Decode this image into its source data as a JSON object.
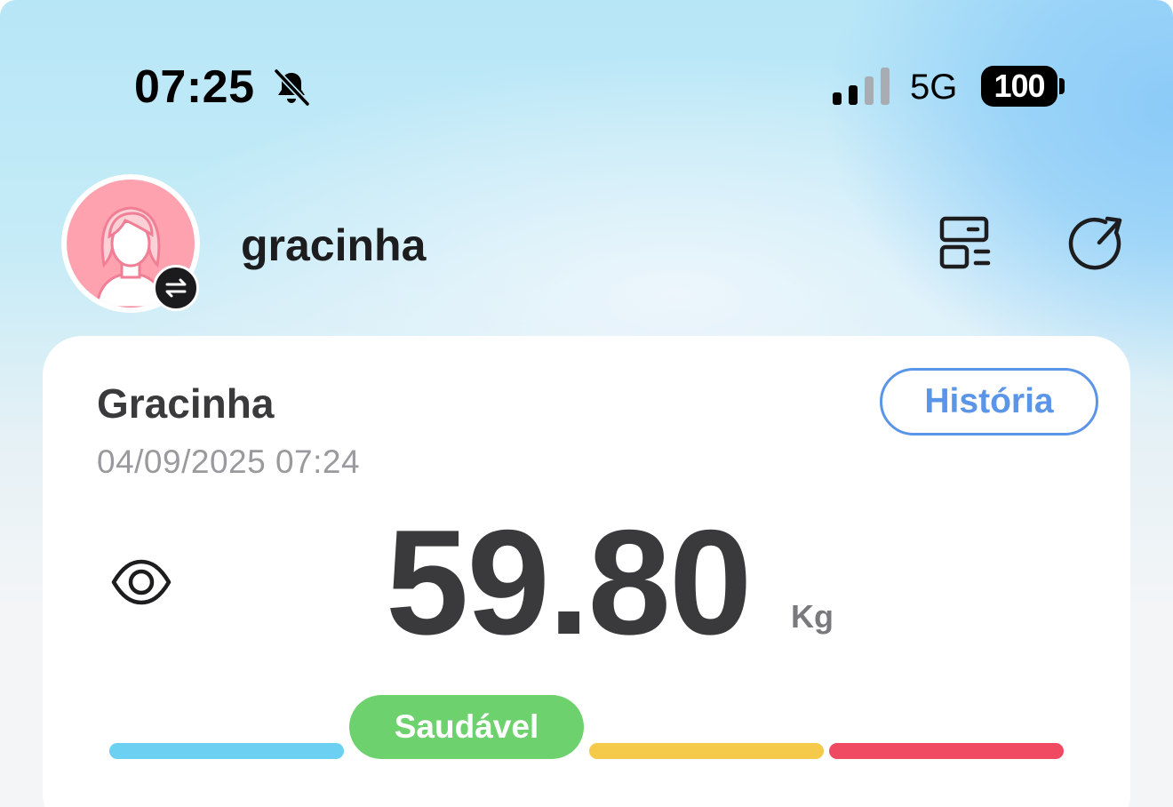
{
  "status_bar": {
    "time": "07:25",
    "silent_icon": "bell-slash-icon",
    "signal_icon": "cellular-signal-icon",
    "network": "5G",
    "battery": "100"
  },
  "profile": {
    "username": "gracinha",
    "avatar_icon": "female-user-avatar",
    "switch_icon": "swap-arrows-icon",
    "device_icon": "device-manage-icon",
    "refresh_icon": "refresh-icon"
  },
  "measurement": {
    "name": "Gracinha",
    "datetime": "04/09/2025 07:24",
    "history_label": "História",
    "visibility_icon": "eye-icon",
    "weight": "59.80",
    "unit": "Kg",
    "status_label": "Saudável"
  },
  "range_bar": {
    "segments": [
      {
        "color": "#6bd0f2"
      },
      {
        "color": "#6dd16e"
      },
      {
        "color": "#f5c94a"
      },
      {
        "color": "#ef4a62"
      }
    ],
    "active_index": 1
  }
}
